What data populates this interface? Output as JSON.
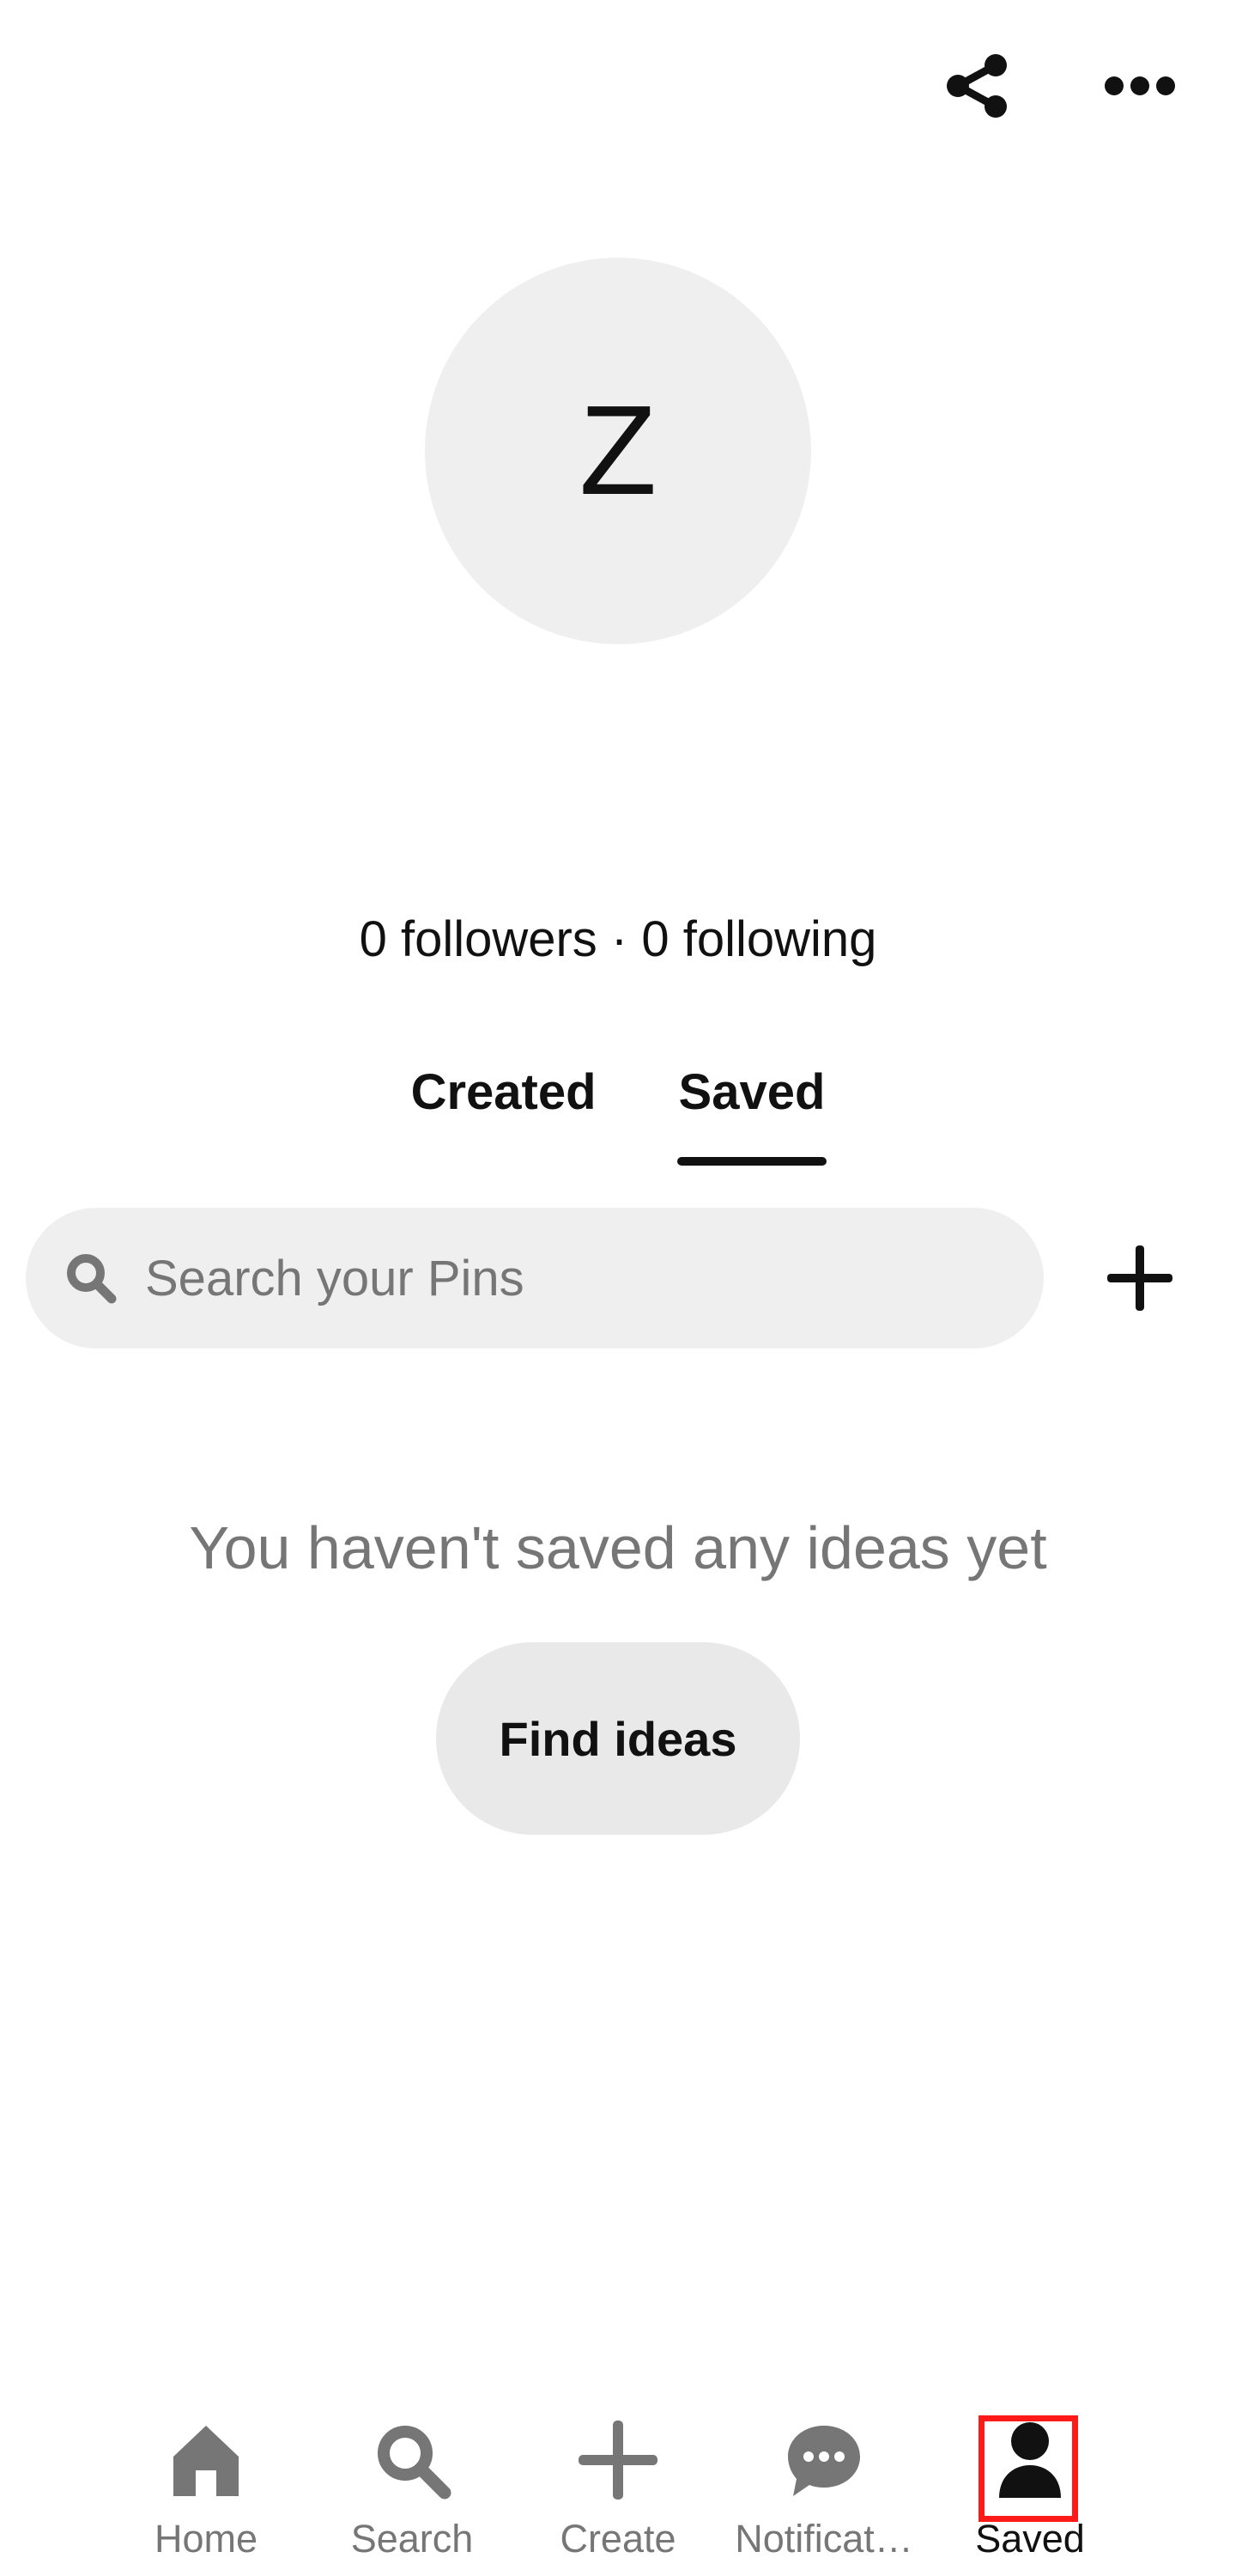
{
  "header": {
    "share_icon": "share-icon",
    "more_icon": "more-horizontal-icon"
  },
  "profile": {
    "avatar_letter": "Z",
    "stats": "0 followers · 0 following"
  },
  "tabs": [
    {
      "label": "Created",
      "active": false
    },
    {
      "label": "Saved",
      "active": true
    }
  ],
  "search": {
    "placeholder": "Search your Pins",
    "value": "",
    "icon": "search-icon"
  },
  "add_icon": "plus-icon",
  "empty_state": {
    "message": "You haven't saved any ideas yet",
    "button_label": "Find ideas"
  },
  "nav": {
    "items": [
      {
        "label": "Home",
        "icon": "home-icon",
        "active": false
      },
      {
        "label": "Search",
        "icon": "search-icon",
        "active": false
      },
      {
        "label": "Create",
        "icon": "plus-icon",
        "active": false
      },
      {
        "label": "Notificat…",
        "icon": "chat-bubble-icon",
        "active": false
      },
      {
        "label": "Saved",
        "icon": "profile-icon",
        "active": true
      }
    ]
  },
  "colors": {
    "text_primary": "#111111",
    "text_secondary": "#767676",
    "surface_gray": "#efefef",
    "highlight": "#ff1a1a"
  }
}
